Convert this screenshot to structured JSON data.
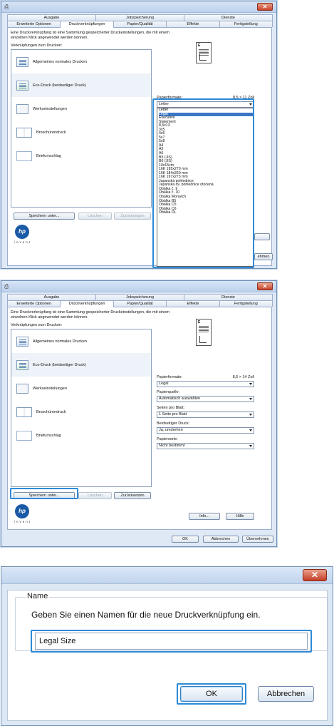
{
  "shared": {
    "close_glyph": "✕",
    "app_icon": "printer-icon",
    "tabs_top": [
      "Ausgabe",
      "Jobspeicherung",
      "Dienste"
    ],
    "tabs_bottom": [
      "Erweiterte Optionen",
      "Druckverknüpfungen",
      "Papier/Qualität",
      "Effekte",
      "Fertigstellung"
    ],
    "description": "Eine Druckverknüpfung ist eine Sammlung gespeicherter Druckeinstellungen, die mit einem einzelnen Klick angewendet werden können.",
    "list_label": "Verknüpfungen zum Drucken:",
    "presets": [
      "Allgemeines normales Drucken",
      "Eco-Druck (beidseitiger Druck)",
      "Werkseinstellungen",
      "Broschürendruck",
      "Briefumschlag"
    ],
    "buttons": {
      "save_as": "Speichern unter...",
      "delete": "Löschen",
      "reset": "Zurücksetzen",
      "info": "Info...",
      "help": "Hilfe",
      "ok": "OK",
      "cancel": "Abbrechen",
      "apply": "Übernehmen"
    },
    "logo_text": "hp",
    "invent_text": "invent",
    "preview_letter": "E"
  },
  "dialog1": {
    "paper_format_label": "Papierformate:",
    "paper_format_size": "8,5 × 11 Zoll",
    "dropdown_value": "Letter",
    "apply_partial": "ehmen",
    "options": [
      "Letter",
      "Legal",
      "Executive",
      "Statement",
      "8,5x13",
      "3x5",
      "4x6",
      "5x7",
      "5x8",
      "A4",
      "A5",
      "A6",
      "B5 (JIS)",
      "B6 (JIS)",
      "10x15cm",
      "16K 195x270 mm",
      "16K 184x260 mm",
      "16K 197x273 mm",
      "Japanská pohlednice",
      "Japanská dv. pohlednice otočená",
      "Obálka č. 9",
      "Obálka č. 10",
      "Obálka Monarch",
      "Obálka B5",
      "Obálka C5",
      "Obálka C6",
      "Obálka DL"
    ],
    "highlighted_option": "Legal"
  },
  "dialog2": {
    "paper_format_label": "Papierformate:",
    "paper_format_size": "8,5 × 14 Zoll",
    "paper_format_value": "Legal",
    "paper_source_label": "Papierquelle:",
    "paper_source_value": "Automatisch auswählen",
    "pages_per_sheet_label": "Seiten pro Blatt:",
    "pages_per_sheet_value": "1 Seite pro Blatt",
    "duplex_label": "Beidseitiger Druck:",
    "duplex_value": "Ja, umdrehen",
    "paper_type_label": "Papiersorte:",
    "paper_type_value": "Nicht bestimmt"
  },
  "dialog3": {
    "close_glyph": "✕",
    "group_label": "Name",
    "prompt": "Geben Sie einen Namen für die neue Druckverknüpfung ein.",
    "input_value": "Legal Size",
    "ok_label": "OK",
    "cancel_label": "Abbrechen"
  },
  "colors": {
    "highlight": "#2d8ad8",
    "selection": "#3a76c4",
    "close": "#c8432b"
  }
}
